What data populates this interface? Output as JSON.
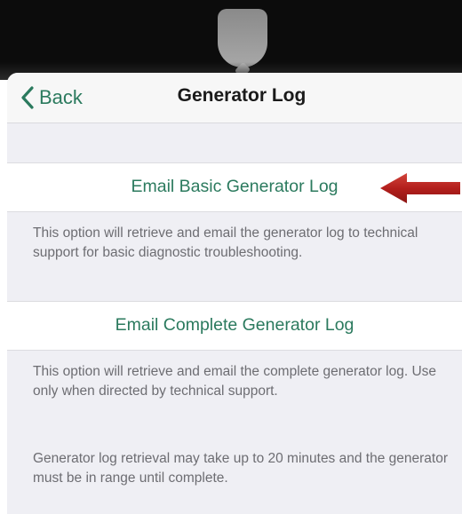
{
  "nav": {
    "back_label": "Back",
    "title": "Generator Log"
  },
  "options": [
    {
      "label": "Email Basic Generator Log",
      "description": "This option will retrieve and email the generator log to technical support for basic diagnostic troubleshooting."
    },
    {
      "label": "Email Complete Generator Log",
      "description": "This option will retrieve and email the complete generator log. Use only when directed by technical support."
    }
  ],
  "retrieval_note": "Generator log retrieval may take up to 20 minutes and the generator must be in range until complete.",
  "colors": {
    "accent": "#2b7a5e",
    "arrow": "#b31f1c",
    "background": "#efeff4"
  },
  "icons": {
    "back": "chevron-left-icon",
    "pointer": "arrow-left-icon"
  }
}
